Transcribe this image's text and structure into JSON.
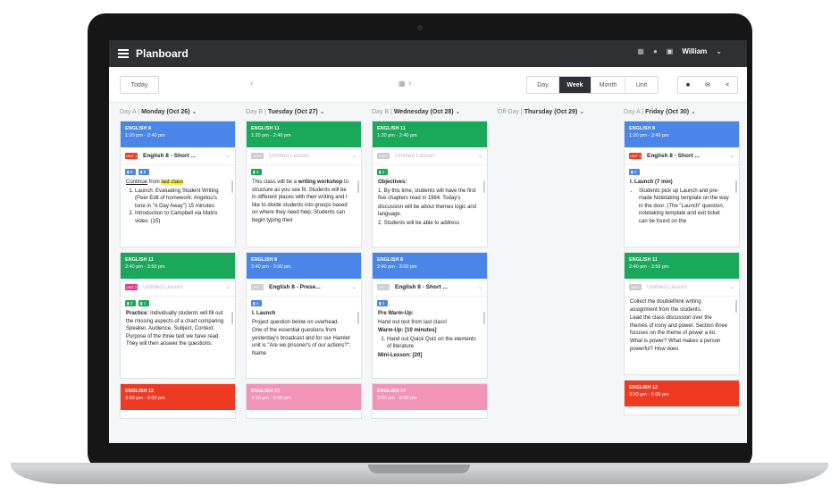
{
  "app": {
    "title": "Planboard",
    "user": "William"
  },
  "toolbar": {
    "today": "Today",
    "prev": "‹",
    "next": "›",
    "views": [
      "Day",
      "Week",
      "Month",
      "Unit"
    ],
    "active_view": "Week"
  },
  "colors": {
    "blue": "#4a86e8",
    "green": "#1aa85a",
    "red": "#ee3a23",
    "pink": "#f294b7",
    "dark": "#2f3033"
  },
  "days": [
    {
      "prefix": "Day A |",
      "label": "Monday (Oct 26)",
      "cards": [
        {
          "title": "ENGLISH 8",
          "time": "1:20 pm - 2:40 pm",
          "color": "#4a86e8",
          "pill": "UNIT 1",
          "pill_color": "#ee3a23",
          "lesson": "English 8 - Short ...",
          "tags": [
            "8",
            "8"
          ],
          "lines": [
            "<span class='ul'>Continue</span> from <span class='hl'>last class</span>",
            "<ol><li>Launch: Evaluating Student Writing (Peer Edit of homework: Angelou's tone in \"A Day Away\") 15 minutes</li><li>Introduction to Campbell via Matrix video: (15)</li></ol>"
          ]
        },
        {
          "title": "ENGLISH 11",
          "time": "2:40 pm - 3:50 pm",
          "color": "#1aa85a",
          "pill": "UNIT 2",
          "pill_color": "#e03a8c",
          "lesson": "Untitled Lesson",
          "placeholder": true,
          "tags": [
            "3",
            "1"
          ],
          "lines": [
            "<b>Practice:</b> Individually students will fill out the missing aspects of a chart comparing Speaker, Audience, Subject, Context, Purpose of the three text we have read. They will then answer the questions:"
          ]
        },
        {
          "title": "ENGLISH 12",
          "time": "3:50 pm - 5:00 pm",
          "color": "#ee3a23",
          "short": true
        }
      ]
    },
    {
      "prefix": "Day B |",
      "label": "Tuesday (Oct 27)",
      "cards": [
        {
          "title": "ENGLISH 11",
          "time": "1:20 pm - 2:40 pm",
          "color": "#1aa85a",
          "pill": "UNIT",
          "pill_color": "#ccc",
          "lesson": "Untitled Lesson",
          "placeholder": true,
          "tags": [
            "3"
          ],
          "lines": [
            "This class will be a <b>writing workshop</b> to structure as you see fit. Students will be in different places with their writing and I like to divide students into groups based on where they need help. Students can begin typing their"
          ]
        },
        {
          "title": "ENGLISH 8",
          "time": "2:40 pm - 3:50 pm",
          "color": "#4a86e8",
          "pill": "UNIT 1",
          "pill_color": "#ccc",
          "lesson": "English 8 - Prese...",
          "tags": [
            "4"
          ],
          "lines": [
            "<b>I. Launch</b>",
            "Project question below on overhead.",
            "One of the essential questions from yesterday's broadcast and for our Hamlet unit is \"Are we prisoner's of our actions?\". Name"
          ]
        },
        {
          "title": "ENGLISH 10",
          "time": "3:50 pm - 5:00 pm",
          "color": "#f294b7",
          "short": true
        }
      ]
    },
    {
      "prefix": "Day B |",
      "label": "Wednesday (Oct 28)",
      "cards": [
        {
          "title": "ENGLISH 11",
          "time": "1:20 pm - 2:40 pm",
          "color": "#1aa85a",
          "pill": "UNIT",
          "pill_color": "#ccc",
          "lesson": "Untitled Lesson",
          "placeholder": true,
          "tags": [
            "4"
          ],
          "lines": [
            "<b>Objectives:</b>",
            "1. By this time, students will have the first five chapters read in 1984. Today's",
            "discussion will be about themes logic and language.",
            "2. Students will be able to address"
          ]
        },
        {
          "title": "ENGLISH 8",
          "time": "2:40 pm - 3:50 pm",
          "color": "#4a86e8",
          "pill": "UNIT 1",
          "pill_color": "#ccc",
          "lesson": "English 8 - Short ...",
          "tags": [
            "2"
          ],
          "lines": [
            "<b>Pre Warm-Up:</b>",
            "Hand out test from last class!",
            "<b>Warm-Up: [10 minutes]</b>",
            "<ol><li>Hand out Quick Quiz on the elements of literature</li></ol>",
            "<b>Mini-Lesson: [20]</b>"
          ]
        },
        {
          "title": "ENGLISH 10",
          "time": "3:50 pm - 5:00 pm",
          "color": "#f294b7",
          "short": true
        }
      ]
    },
    {
      "prefix": "Off-Day |",
      "label": "Thursday (Oct 29)",
      "cards": []
    },
    {
      "prefix": "Day A |",
      "label": "Friday (Oct 30)",
      "cards": [
        {
          "title": "ENGLISH 8",
          "time": "1:20 pm - 2:40 pm",
          "color": "#4a86e8",
          "pill": "UNIT 1",
          "pill_color": "#ee3a23",
          "lesson": "English 8 - Short ...",
          "tags": [
            "4"
          ],
          "lines": [
            "<b>I. Launch (7 min)</b>",
            "<ul><li>Students pick up Launch and pre-made Notetaking template on the way in the door. (The \"Launch\" question, notetaking template and exit ticket can be found on the</li></ul>"
          ]
        },
        {
          "title": "ENGLISH 11",
          "time": "2:40 pm - 3:50 pm",
          "color": "#1aa85a",
          "pill": "UNIT",
          "pill_color": "#ccc",
          "lesson": "Untitled Lesson",
          "placeholder": true,
          "tags": [],
          "lines": [
            "Collect the doublethink writing assignment from the students.",
            "Lead the class discussion over the themes of irony and power. Section three focuses on the theme of power a lot. What is power? What makes a person powerful? How does"
          ]
        },
        {
          "title": "ENGLISH 12",
          "time": "3:50 pm - 5:00 pm",
          "color": "#ee3a23",
          "short": true
        }
      ]
    }
  ]
}
